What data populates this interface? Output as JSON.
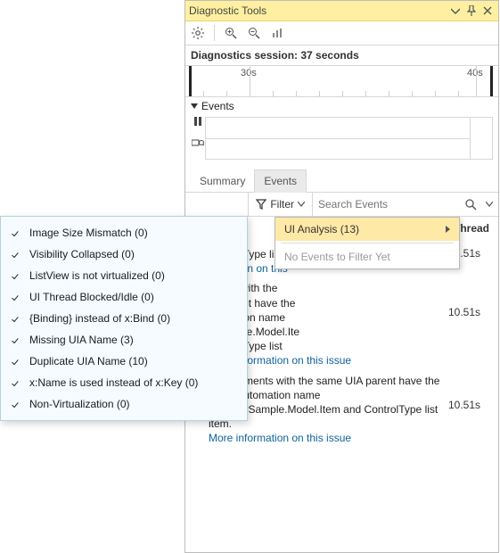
{
  "window": {
    "title": "Diagnostic Tools",
    "session_label": "Diagnostics session: 37 seconds",
    "ruler": {
      "labels": [
        "30s",
        "40s"
      ]
    },
    "events_header": "Events"
  },
  "tabs": {
    "summary": "Summary",
    "events": "Events"
  },
  "filterbar": {
    "filter_label": "Filter",
    "search_placeholder": "Search Events"
  },
  "filter_menu": {
    "ui_analysis": "UI Analysis (13)",
    "no_events": "No Events to Filter Yet"
  },
  "columns": {
    "thread": "Thread"
  },
  "issues": [
    {
      "text_tail": "ControlType list",
      "link": "formation on this",
      "time": "10.51s"
    },
    {
      "text": "ments with the\nIA parent have the\nutomation name\nwSample.Model.Ite\nControlType list",
      "link": "More information on this issue",
      "time": "10.51s"
    },
    {
      "text": "UIA Elements with the same UIA parent have the same automation name ListViewSample.Model.Item and ControlType list item.",
      "link": "More information on this issue",
      "time": "10.51s"
    }
  ],
  "submenu": [
    "Image Size Mismatch (0)",
    "Visibility Collapsed (0)",
    "ListView is not virtualized (0)",
    "UI Thread Blocked/Idle (0)",
    "{Binding} instead of x:Bind (0)",
    "Missing UIA Name (3)",
    "Duplicate UIA Name (10)",
    "x:Name is used instead of x:Key (0)",
    "Non-Virtualization (0)"
  ]
}
